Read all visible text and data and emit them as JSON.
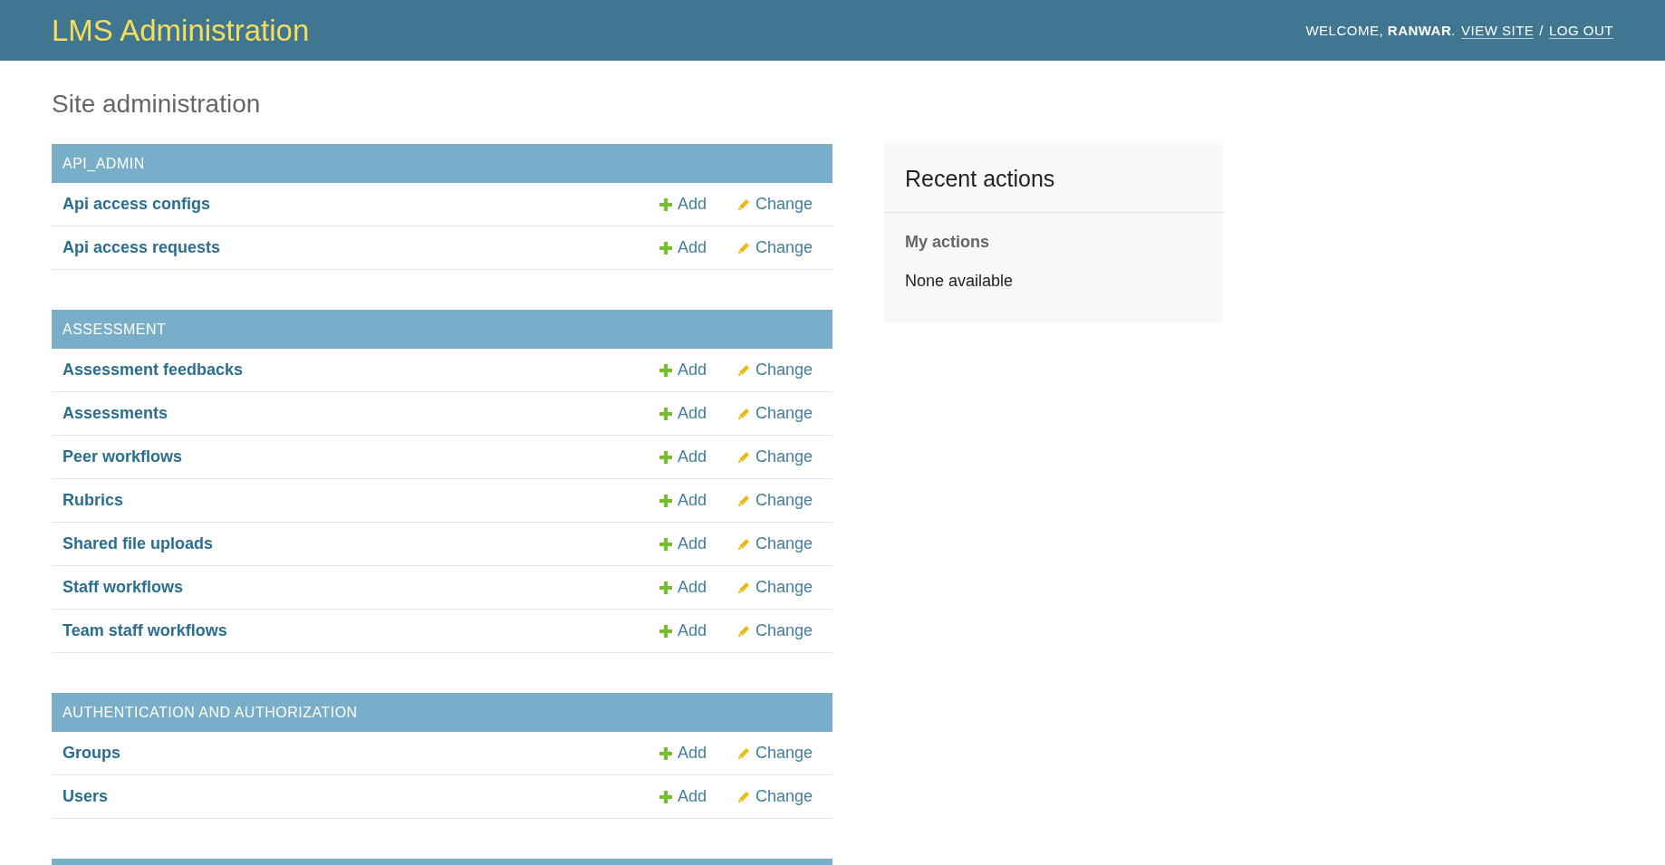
{
  "header": {
    "brand": "LMS Administration",
    "welcome": "WELCOME,",
    "user": "RANWAR",
    "user_end": ".",
    "links": [
      "VIEW SITE",
      "LOG OUT"
    ],
    "separator": "/"
  },
  "page_title": "Site administration",
  "modules": [
    {
      "caption": "API_ADMIN",
      "rows": [
        {
          "name": "Api access configs",
          "add": "Add",
          "change": "Change"
        },
        {
          "name": "Api access requests",
          "add": "Add",
          "change": "Change"
        }
      ]
    },
    {
      "caption": "ASSESSMENT",
      "rows": [
        {
          "name": "Assessment feedbacks",
          "add": "Add",
          "change": "Change"
        },
        {
          "name": "Assessments",
          "add": "Add",
          "change": "Change"
        },
        {
          "name": "Peer workflows",
          "add": "Add",
          "change": "Change"
        },
        {
          "name": "Rubrics",
          "add": "Add",
          "change": "Change"
        },
        {
          "name": "Shared file uploads",
          "add": "Add",
          "change": "Change"
        },
        {
          "name": "Staff workflows",
          "add": "Add",
          "change": "Change"
        },
        {
          "name": "Team staff workflows",
          "add": "Add",
          "change": "Change"
        }
      ]
    },
    {
      "caption": "AUTHENTICATION AND AUTHORIZATION",
      "rows": [
        {
          "name": "Groups",
          "add": "Add",
          "change": "Change"
        },
        {
          "name": "Users",
          "add": "Add",
          "change": "Change"
        }
      ]
    }
  ],
  "cut_off_module_header": true,
  "recent_actions": {
    "title": "Recent actions",
    "subtitle": "My actions",
    "empty_text": "None available"
  }
}
